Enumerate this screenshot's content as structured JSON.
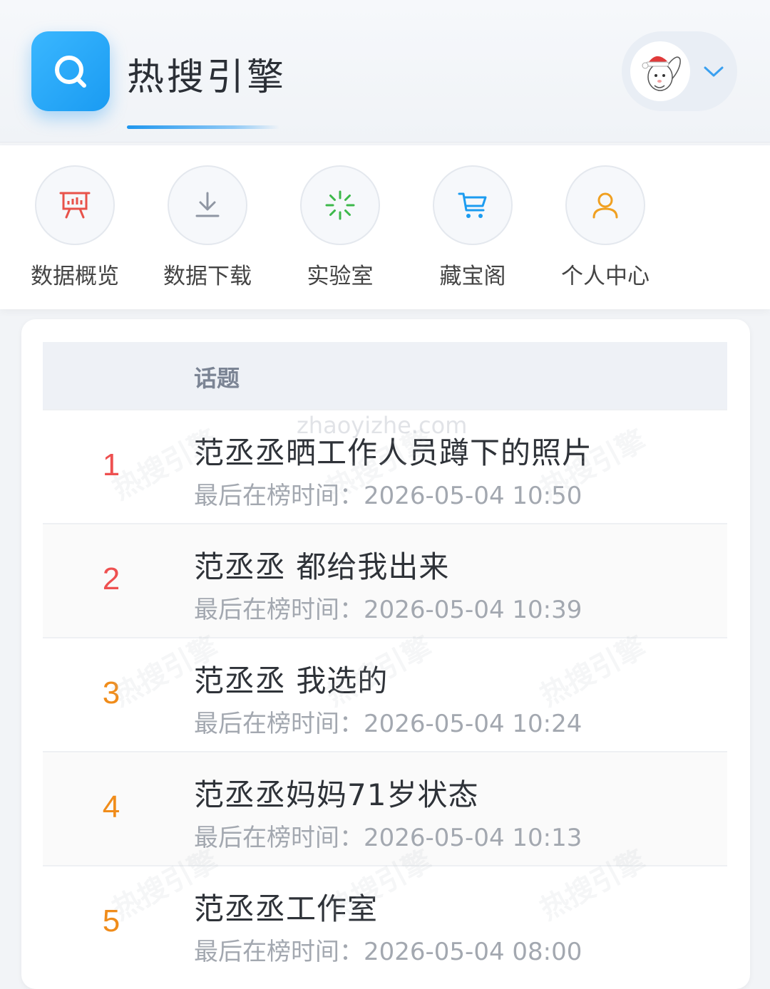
{
  "header": {
    "app_title": "热搜引擎",
    "logo_icon": "search-icon",
    "avatar_icon": "bunny-avatar",
    "dropdown_icon": "chevron-down-icon"
  },
  "nav": [
    {
      "label": "数据概览",
      "icon": "presentation-chart-icon",
      "color": "#e8524a"
    },
    {
      "label": "数据下载",
      "icon": "download-icon",
      "color": "#8f96a3"
    },
    {
      "label": "实验室",
      "icon": "loading-spinner-icon",
      "color": "#3cb84a"
    },
    {
      "label": "藏宝阁",
      "icon": "shopping-cart-icon",
      "color": "#1c9cf0"
    },
    {
      "label": "个人中心",
      "icon": "user-icon",
      "color": "#f0a020"
    }
  ],
  "table": {
    "header_label": "话题",
    "rows": [
      {
        "rank": "1",
        "topic": "范丞丞晒工作人员蹲下的照片",
        "time": "最后在榜时间：2026-05-04 10:50"
      },
      {
        "rank": "2",
        "topic": "范丞丞 都给我出来",
        "time": "最后在榜时间：2026-05-04 10:39"
      },
      {
        "rank": "3",
        "topic": "范丞丞 我选的",
        "time": "最后在榜时间：2026-05-04 10:24"
      },
      {
        "rank": "4",
        "topic": "范丞丞妈妈71岁状态",
        "time": "最后在榜时间：2026-05-04 10:13"
      },
      {
        "rank": "5",
        "topic": "范丞丞工作室",
        "time": "最后在榜时间：2026-05-04 08:00"
      }
    ]
  },
  "watermark": {
    "text": "热搜引擎",
    "url": "zhaoyizhe.com"
  },
  "colors": {
    "accent": "#1e96ee",
    "rank_top": "#ee5050",
    "rank_mid": "#f08c1a"
  }
}
